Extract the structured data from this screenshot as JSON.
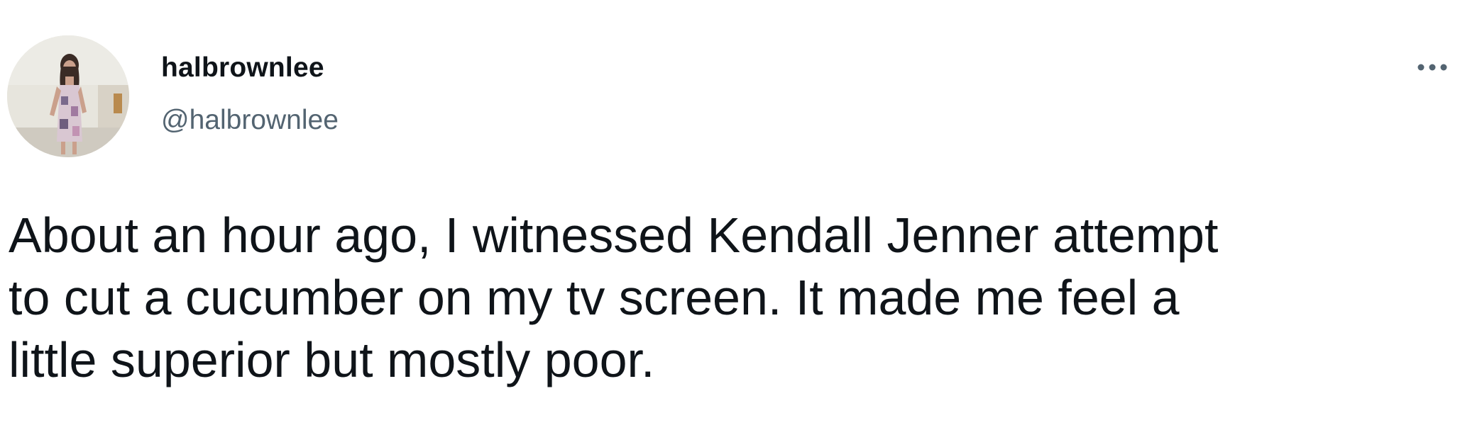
{
  "author": {
    "display_name": "halbrownlee",
    "handle": "@halbrownlee"
  },
  "more_menu": {
    "icon": "more-horizontal-icon"
  },
  "tweet": {
    "lines": [
      "About an hour ago, I witnessed Kendall Jenner attempt",
      "to cut a cucumber on my tv screen. It made me feel a",
      "little superior but mostly poor."
    ]
  },
  "colors": {
    "text": "#0f1419",
    "secondary_text": "#536471",
    "background": "#ffffff"
  }
}
